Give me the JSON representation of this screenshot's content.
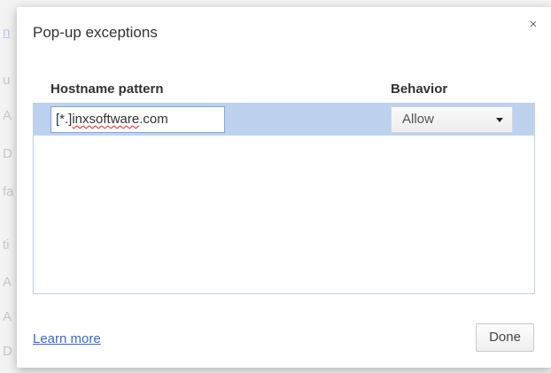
{
  "dialog": {
    "title": "Pop-up exceptions",
    "close_symbol": "×"
  },
  "columns": {
    "hostname_header": "Hostname pattern",
    "behavior_header": "Behavior"
  },
  "rows": [
    {
      "hostname_prefix": "[*.]",
      "hostname_misspelled": "inxsoftware",
      "hostname_suffix": ".com",
      "behavior": "Allow"
    }
  ],
  "footer": {
    "learn_more": "Learn more",
    "done_label": "Done"
  },
  "colors": {
    "row_highlight": "#bdd2ef",
    "link": "#3b69c6"
  },
  "icons": {
    "close": "close-icon",
    "dropdown": "chevron-down-icon"
  }
}
